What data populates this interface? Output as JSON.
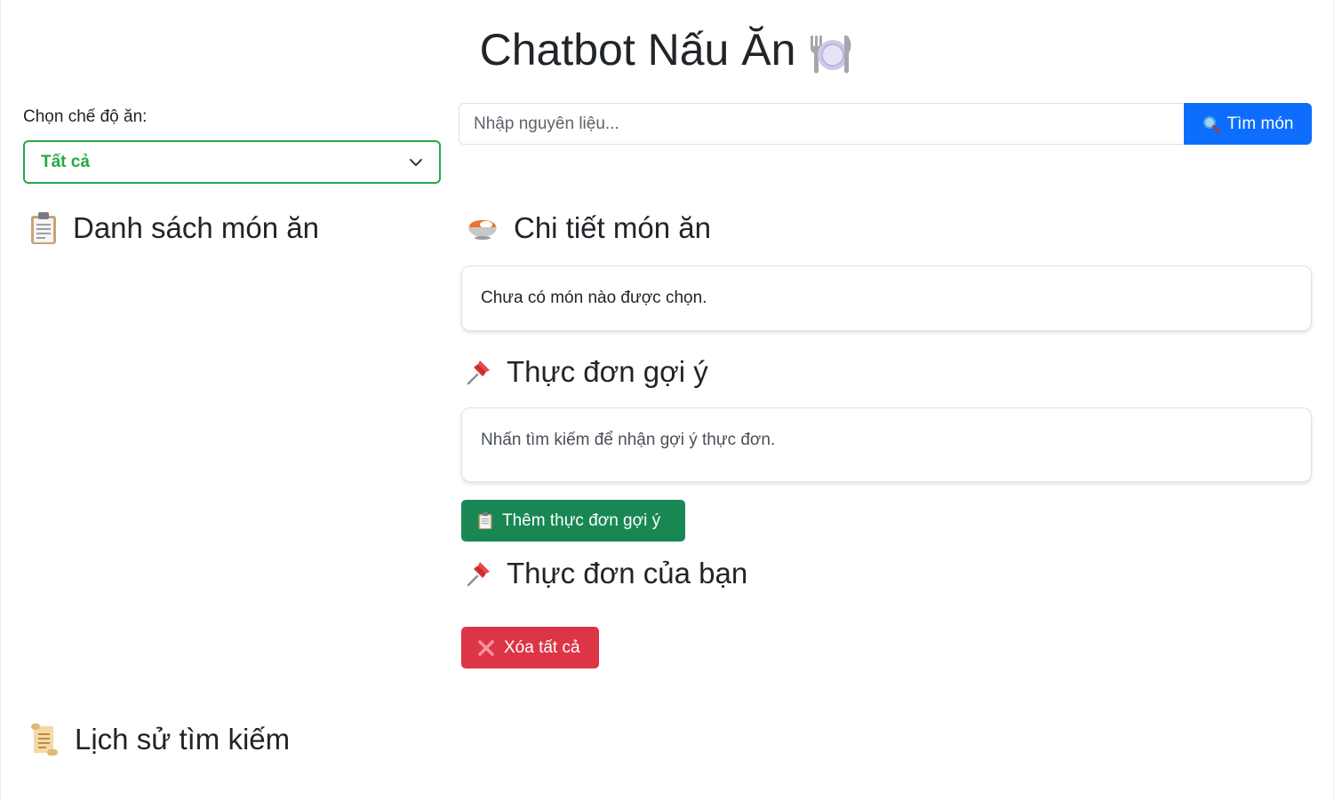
{
  "app": {
    "title": "Chatbot Nấu Ăn"
  },
  "diet": {
    "label": "Chọn chế độ ăn:",
    "selected": "Tất cả"
  },
  "search": {
    "placeholder": "Nhập nguyên liệu...",
    "button_label": "Tìm món"
  },
  "sections": {
    "dish_list": "Danh sách món ăn",
    "dish_detail": "Chi tiết món ăn",
    "suggested_menu": "Thực đơn gợi ý",
    "your_menu": "Thực đơn của bạn",
    "history": "Lịch sử tìm kiếm"
  },
  "detail": {
    "empty_text": "Chưa có món nào được chọn."
  },
  "suggest": {
    "hint_text": "Nhấn tìm kiếm để nhận gợi ý thực đơn.",
    "add_button": "Thêm thực đơn gợi ý"
  },
  "your_menu": {
    "clear_button": "Xóa tất cả"
  },
  "icons": {
    "title": "plate-fork-knife-icon",
    "search": "magnifier-icon",
    "dish_list": "clipboard-icon",
    "dish_detail": "curry-bowl-icon",
    "suggested_menu": "pushpin-icon",
    "your_menu": "pushpin-icon",
    "history": "scroll-icon",
    "add": "clipboard-icon",
    "clear": "cross-mark-icon"
  },
  "colors": {
    "primary": "#0d6efd",
    "success": "#198754",
    "success_border": "#28a745",
    "danger": "#dc3545"
  }
}
